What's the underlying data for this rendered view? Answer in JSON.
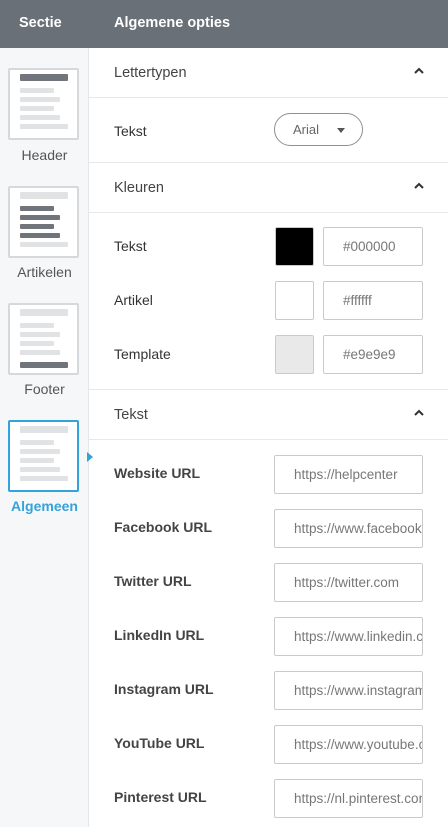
{
  "header": {
    "section_label": "Sectie",
    "options_label": "Algemene opties"
  },
  "sidebar": {
    "items": [
      {
        "label": "Header"
      },
      {
        "label": "Artikelen"
      },
      {
        "label": "Footer"
      },
      {
        "label": "Algemeen",
        "active": true
      }
    ]
  },
  "fonts_section": {
    "title": "Lettertypen",
    "text_label": "Tekst",
    "font_value": "Arial"
  },
  "colors_section": {
    "title": "Kleuren",
    "rows": [
      {
        "label": "Tekst",
        "color": "#000000",
        "value": "#000000"
      },
      {
        "label": "Artikel",
        "color": "#ffffff",
        "value": "#ffffff"
      },
      {
        "label": "Template",
        "color": "#e9e9e9",
        "value": "#e9e9e9"
      }
    ]
  },
  "text_section": {
    "title": "Tekst",
    "rows": [
      {
        "label": "Website URL",
        "value": "https://helpcenter"
      },
      {
        "label": "Facebook URL",
        "value": "https://www.facebook.com"
      },
      {
        "label": "Twitter URL",
        "value": "https://twitter.com"
      },
      {
        "label": "LinkedIn URL",
        "value": "https://www.linkedin.com"
      },
      {
        "label": "Instagram URL",
        "value": "https://www.instagram.com"
      },
      {
        "label": "YouTube URL",
        "value": "https://www.youtube.com"
      },
      {
        "label": "Pinterest URL",
        "value": "https://nl.pinterest.com"
      }
    ]
  },
  "accent_color": "#33a3dc",
  "icons": {
    "collapse": "chevron-up-icon",
    "dropdown": "caret-down-icon"
  }
}
